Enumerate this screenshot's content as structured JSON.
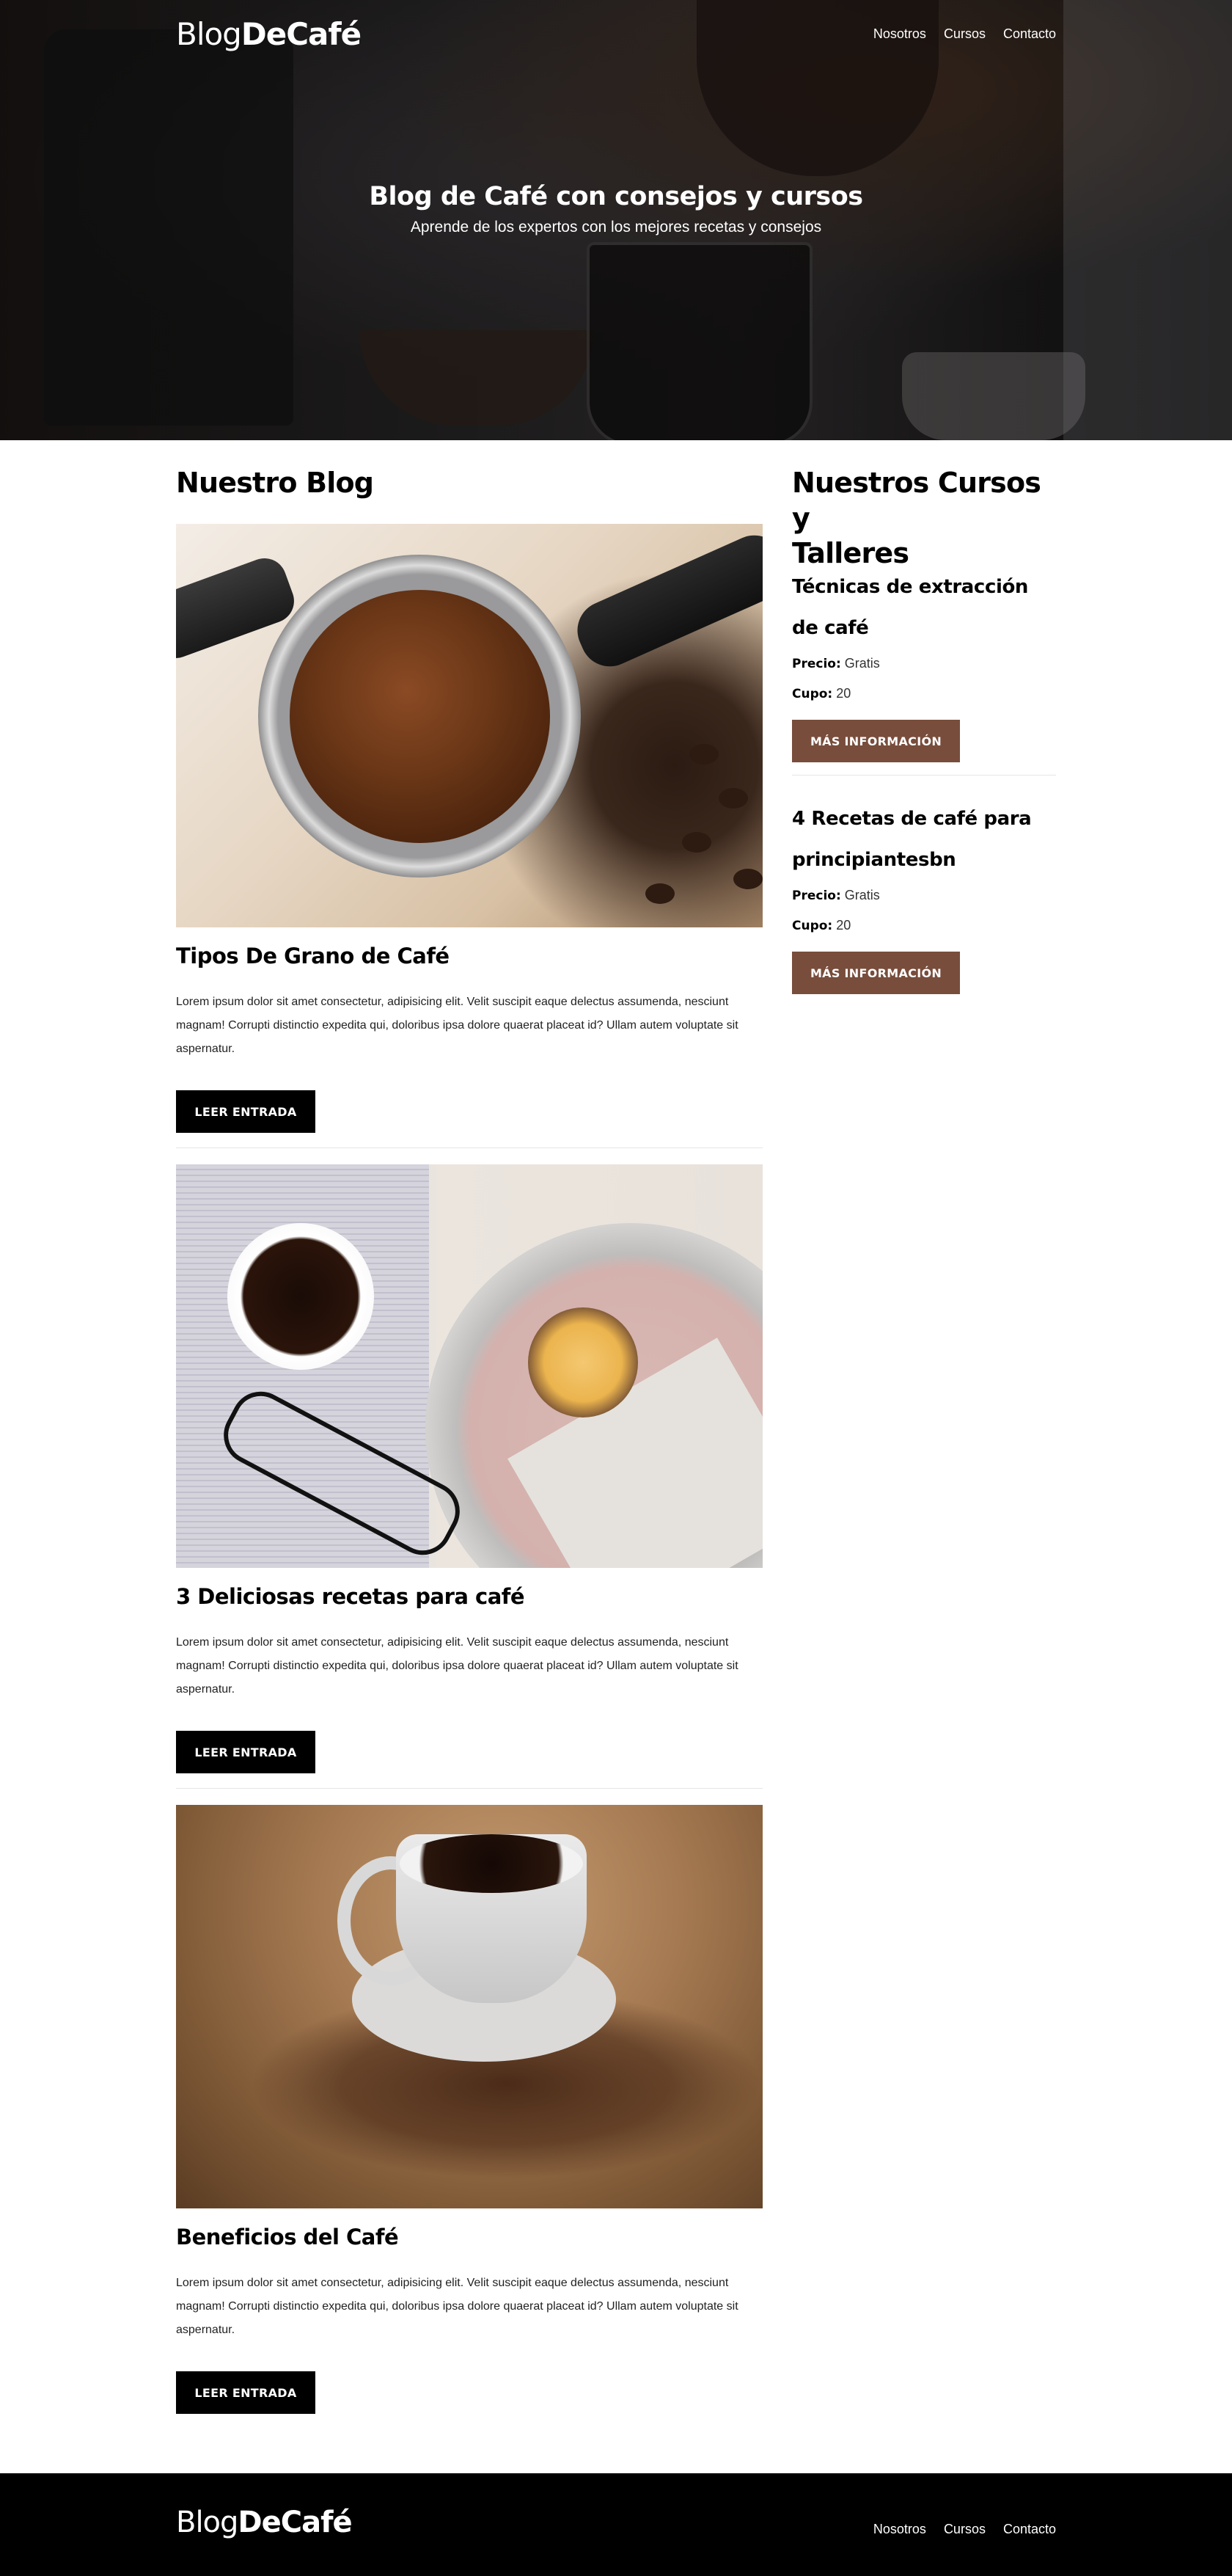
{
  "header": {
    "logo_light": "Blog",
    "logo_bold": "DeCafé",
    "nav": [
      "Nosotros",
      "Cursos",
      "Contacto"
    ],
    "hero_title": "Blog de Café con consejos y cursos",
    "hero_subtitle": "Aprende de los expertos con los mejores recetas y consejos"
  },
  "blog": {
    "title": "Nuestro Blog",
    "entries": [
      {
        "title": "Tipos De Grano de Café",
        "text": "Lorem ipsum dolor sit amet consectetur, adipisicing elit. Velit suscipit eaque delectus assumenda, nesciunt magnam! Corrupti distinctio expedita qui, doloribus ipsa dolore quaerat placeat id? Ullam autem voluptate sit aspernatur.",
        "button": "LEER ENTRADA"
      },
      {
        "title": "3 Deliciosas recetas para café",
        "text": "Lorem ipsum dolor sit amet consectetur, adipisicing elit. Velit suscipit eaque delectus assumenda, nesciunt magnam! Corrupti distinctio expedita qui, doloribus ipsa dolore quaerat placeat id? Ullam autem voluptate sit aspernatur.",
        "button": "LEER ENTRADA"
      },
      {
        "title": "Beneficios del Café",
        "text": "Lorem ipsum dolor sit amet consectetur, adipisicing elit. Velit suscipit eaque delectus assumenda, nesciunt magnam! Corrupti distinctio expedita qui, doloribus ipsa dolore quaerat placeat id? Ullam autem voluptate sit aspernatur.",
        "button": "LEER ENTRADA"
      }
    ]
  },
  "courses": {
    "title_line1": "Nuestros Cursos y",
    "title_line2": "Talleres",
    "price_label": "Precio:",
    "slots_label": "Cupo:",
    "items": [
      {
        "title": "Técnicas de extracción de café",
        "price": "Gratis",
        "slots": "20",
        "button": "MÁS INFORMACIÓN"
      },
      {
        "title": "4 Recetas de café para principiantesbn",
        "price": "Gratis",
        "slots": "20",
        "button": "MÁS INFORMACIÓN"
      }
    ]
  },
  "footer": {
    "logo_light": "Blog",
    "logo_bold": "DeCafé",
    "nav": [
      "Nosotros",
      "Cursos",
      "Contacto"
    ]
  },
  "colors": {
    "accent_brown": "#784d3c",
    "button_dark": "#000000",
    "footer_bg": "#000000"
  }
}
